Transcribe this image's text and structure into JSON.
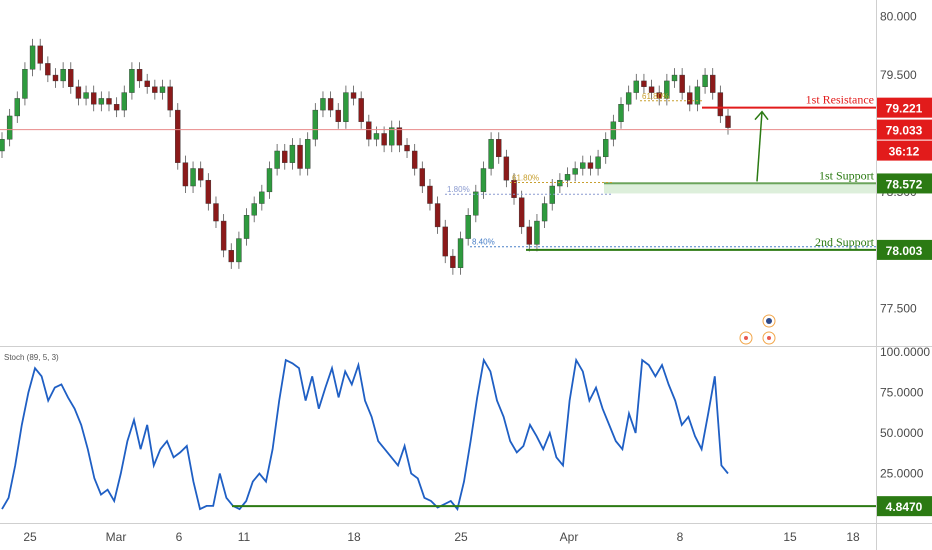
{
  "chart_data": [
    {
      "type": "candlestick",
      "ylim": [
        77.3,
        80.1
      ],
      "y_ticks": [
        "80.000",
        "79.500",
        "78.500",
        "77.500"
      ],
      "current_price": "79.033",
      "countdown": "36:12",
      "levels": [
        {
          "name": "1st Resistance",
          "value": 79.221,
          "label": "79.221",
          "color": "#e21b1b"
        },
        {
          "name": "1st Support",
          "value": 78.572,
          "label": "78.572",
          "color": "#2b7a13"
        },
        {
          "name": "2nd Support",
          "value": 78.003,
          "label": "78.003",
          "color": "#2b7a13"
        }
      ],
      "fib_labels": [
        "61.80%",
        "61.80%",
        "1.80%",
        "8.40%"
      ],
      "ohlc_path_close": [
        78.95,
        79.15,
        79.3,
        79.55,
        79.75,
        79.6,
        79.5,
        79.45,
        79.55,
        79.4,
        79.3,
        79.35,
        79.25,
        79.3,
        79.25,
        79.2,
        79.35,
        79.55,
        79.45,
        79.4,
        79.35,
        79.4,
        79.2,
        78.75,
        78.55,
        78.7,
        78.6,
        78.4,
        78.25,
        78.0,
        77.9,
        78.1,
        78.3,
        78.4,
        78.5,
        78.7,
        78.85,
        78.75,
        78.9,
        78.7,
        78.95,
        79.2,
        79.3,
        79.2,
        79.1,
        79.35,
        79.3,
        79.1,
        78.95,
        79.0,
        78.9,
        79.05,
        78.9,
        78.85,
        78.7,
        78.55,
        78.4,
        78.2,
        77.95,
        77.85,
        78.1,
        78.3,
        78.5,
        78.7,
        78.95,
        78.8,
        78.6,
        78.45,
        78.2,
        78.05,
        78.25,
        78.4,
        78.55,
        78.6,
        78.65,
        78.7,
        78.75,
        78.7,
        78.8,
        78.95,
        79.1,
        79.25,
        79.35,
        79.45,
        79.4,
        79.35,
        79.3,
        79.45,
        79.5,
        79.35,
        79.25,
        79.4,
        79.5,
        79.35,
        79.15,
        79.05
      ]
    },
    {
      "type": "line",
      "title": "Stoch (89, 5, 3)",
      "ylim": [
        0,
        100
      ],
      "y_ticks": [
        "100.0000",
        "75.0000",
        "50.0000",
        "25.0000"
      ],
      "level_value": 4.847,
      "level_label": "4.8470",
      "values": [
        3,
        10,
        30,
        55,
        75,
        90,
        85,
        70,
        78,
        80,
        72,
        65,
        55,
        40,
        22,
        12,
        15,
        8,
        25,
        45,
        58,
        40,
        55,
        30,
        40,
        45,
        35,
        38,
        42,
        20,
        3,
        5,
        5,
        25,
        10,
        5,
        3,
        8,
        20,
        25,
        20,
        40,
        70,
        95,
        93,
        90,
        70,
        85,
        65,
        78,
        90,
        72,
        88,
        80,
        92,
        70,
        60,
        45,
        40,
        35,
        30,
        42,
        25,
        22,
        10,
        8,
        4,
        6,
        8,
        3,
        20,
        45,
        72,
        95,
        88,
        70,
        60,
        45,
        38,
        42,
        55,
        48,
        40,
        50,
        35,
        30,
        70,
        95,
        88,
        70,
        78,
        65,
        55,
        45,
        40,
        62,
        50,
        95,
        92,
        85,
        92,
        80,
        70,
        55,
        60,
        48,
        40,
        62,
        85,
        30,
        25
      ]
    }
  ],
  "x_axis": {
    "tick_labels": [
      "25",
      "Mar",
      "6",
      "11",
      "18",
      "25",
      "Apr",
      "8",
      "15",
      "18"
    ]
  }
}
